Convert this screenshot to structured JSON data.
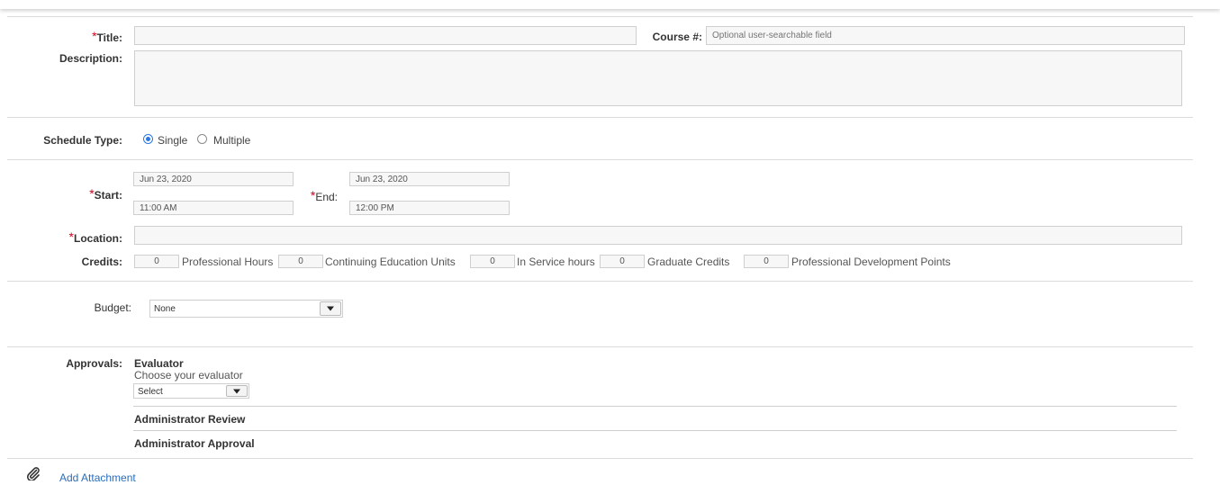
{
  "form": {
    "title": {
      "label": "Title:",
      "value": ""
    },
    "course_number": {
      "label": "Course #:",
      "placeholder": "Optional user-searchable field"
    },
    "description": {
      "label": "Description:",
      "value": ""
    },
    "schedule_type": {
      "label": "Schedule Type:",
      "options": [
        "Single",
        "Multiple"
      ],
      "selected": "Single"
    },
    "start": {
      "label": "Start:",
      "date": "Jun 23, 2020",
      "time": "11:00 AM"
    },
    "end": {
      "label": "End:",
      "date": "Jun 23, 2020",
      "time": "12:00 PM"
    },
    "location": {
      "label": "Location:",
      "value": ""
    },
    "credits": {
      "label": "Credits:",
      "items": [
        {
          "value": "0",
          "unit": "Professional Hours"
        },
        {
          "value": "0",
          "unit": "Continuing Education Units"
        },
        {
          "value": "0",
          "unit": "In Service hours"
        },
        {
          "value": "0",
          "unit": "Graduate Credits"
        },
        {
          "value": "0",
          "unit": "Professional Development Points"
        }
      ]
    },
    "budget": {
      "label": "Budget:",
      "selected": "None"
    },
    "approvals": {
      "label": "Approvals:",
      "evaluator": {
        "title": "Evaluator",
        "subtitle": "Choose your evaluator",
        "selected": "Select"
      },
      "steps": [
        "Administrator Review",
        "Administrator Approval"
      ]
    }
  },
  "attachment": {
    "label": "Add Attachment",
    "icon": "paperclip-icon"
  },
  "colors": {
    "required": "#d0021b",
    "accent": "#2b78e4",
    "link": "#2a6ebb"
  }
}
